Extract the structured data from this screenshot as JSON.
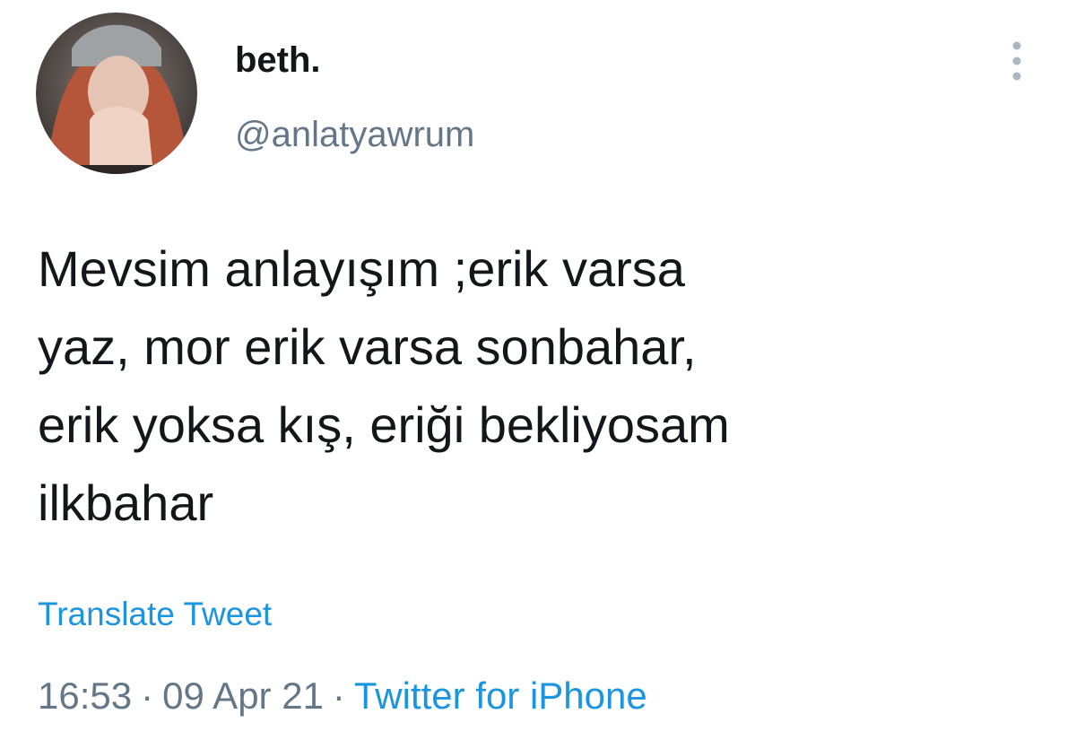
{
  "author": {
    "display_name": "beth.",
    "handle": "@anlatyawrum"
  },
  "tweet": {
    "text": "Mevsim anlayışım ;erik varsa\nyaz, mor erik varsa sonbahar,\nerik yoksa kış, eriği bekliyosam\nilkbahar",
    "translate_label": "Translate Tweet"
  },
  "meta": {
    "time": "16:53",
    "separator": "·",
    "date": "09 Apr 21",
    "source": "Twitter for iPhone"
  },
  "icons": {
    "more": "more-vertical-icon"
  },
  "colors": {
    "text": "#14171a",
    "secondary": "#657786",
    "link": "#1b95e0",
    "background": "#ffffff"
  }
}
